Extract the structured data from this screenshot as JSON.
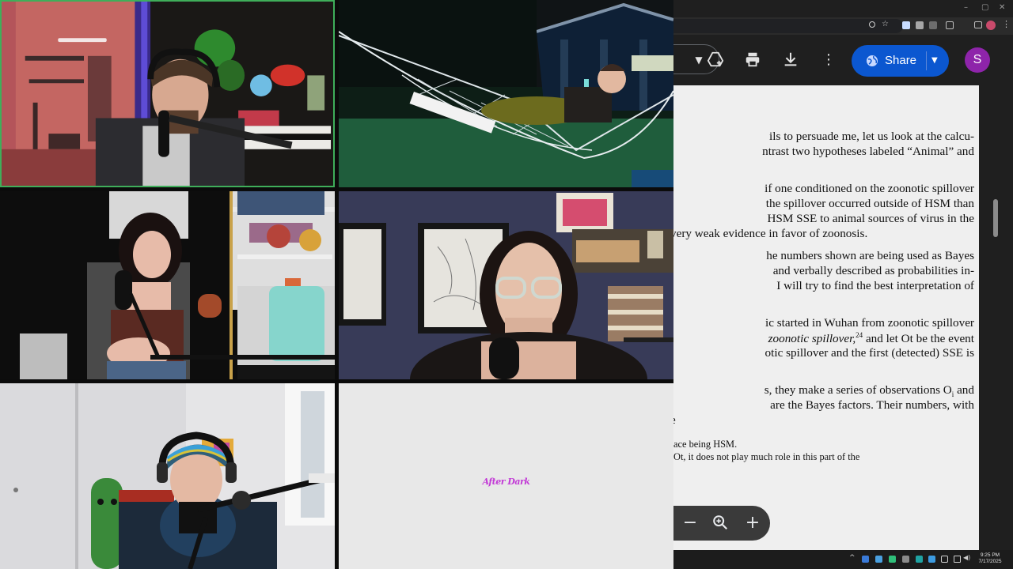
{
  "video_grid": {
    "participants": [
      {
        "slot": 1,
        "speaking": true
      },
      {
        "slot": 2
      },
      {
        "slot": 3
      },
      {
        "slot": 4
      },
      {
        "slot": 5
      },
      {
        "slot": 6,
        "logo_text": "After Dark"
      }
    ]
  },
  "browser": {
    "window_controls": {
      "minimize": "–",
      "maximize": "▢",
      "close": "✕"
    },
    "toolbar": {
      "share_label": "Share",
      "avatar_initial": "S",
      "icons": [
        "add-to-drive-icon",
        "print-icon",
        "download-icon",
        "more-vert-icon",
        "globe-icon",
        "chevron-down-icon"
      ]
    },
    "colors": {
      "share": "#0b57d0",
      "avatar": "#8e24aa"
    },
    "zoom_controls": {
      "minus": "−",
      "plus": "+"
    }
  },
  "document": {
    "lines": [
      "ils to persuade me, let us look at the calcu-",
      "ntrast two hypotheses labeled “Animal” and",
      "if one conditioned on the zoonotic spillover",
      "the spillover occurred outside of HSM than",
      "HSM SSE to animal sources of virus in the",
      "very weak evidence in favor of zoonosis.",
      "he numbers shown are being used as Bayes",
      "and verbally described as probabilities in-",
      "I will try to find the best interpretation of",
      "ic started in Wuhan from zoonotic spillover",
      "and let Ot be the event",
      "otic spillover and the first (detected) SSE is",
      "s, they make a series of observations O",
      "are the Bayes factors. Their numbers, with",
      "e"
    ],
    "line12_italic": "zoonotic spillover,",
    "line12_sup": "24",
    "line15_sub": "i",
    "line15_end": " and",
    "footnotes": [
      "ace being HSM.",
      "Ot, it does not play much role in this part of the"
    ]
  },
  "taskbar": {
    "time": "9:25 PM",
    "date": "7/17/2025",
    "tray_arrow": "^"
  }
}
